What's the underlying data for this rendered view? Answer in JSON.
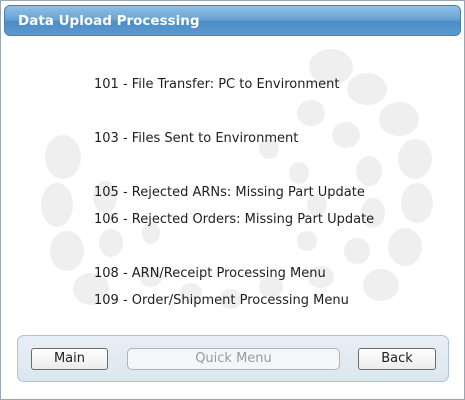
{
  "window": {
    "title": "Data Upload Processing"
  },
  "menu": {
    "items": [
      {
        "label": "101 - File Transfer: PC to Environment"
      },
      {
        "label": "103 - Files Sent to Environment"
      },
      {
        "label": "105 - Rejected ARNs: Missing Part Update"
      },
      {
        "label": "106 - Rejected Orders: Missing Part Update"
      },
      {
        "label": "108 - ARN/Receipt Processing Menu"
      },
      {
        "label": "109 - Order/Shipment Processing Menu"
      }
    ]
  },
  "footer": {
    "main_label": "Main",
    "quick_menu_placeholder": "Quick Menu",
    "back_label": "Back"
  },
  "colors": {
    "titlebar": "#5b9ad0",
    "title_text": "#ffffff",
    "watermark": "#f0f0f0"
  }
}
